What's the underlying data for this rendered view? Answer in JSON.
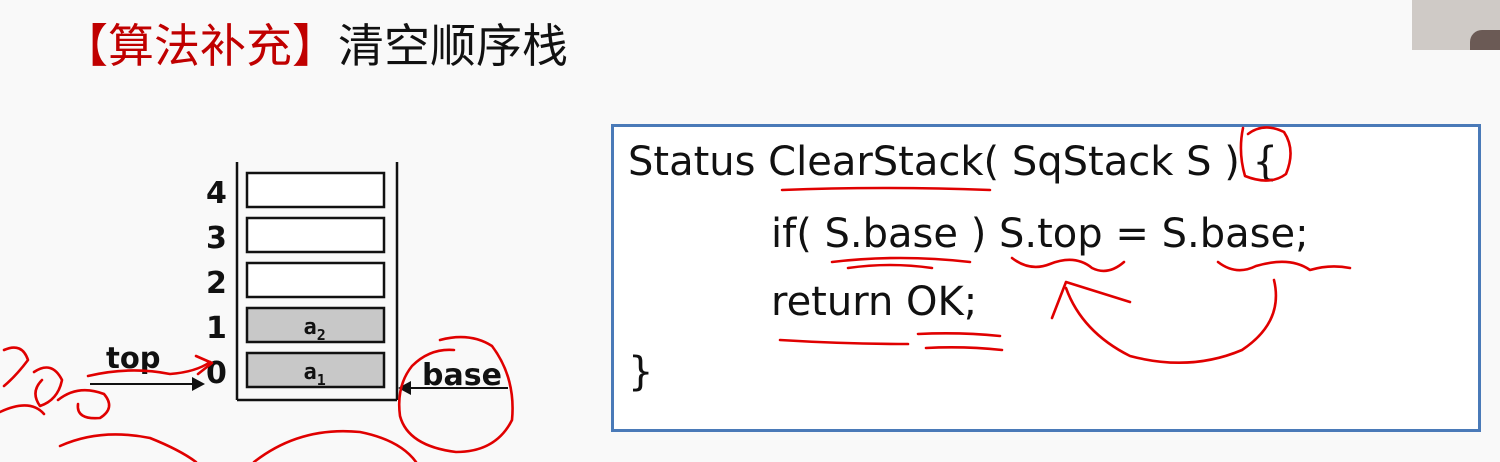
{
  "title": {
    "bracket_text": "【算法补充】",
    "main_text": "清空顺序栈"
  },
  "stack": {
    "indices": [
      "4",
      "3",
      "2",
      "1",
      "0"
    ],
    "cells": [
      {
        "label": "",
        "filled": false
      },
      {
        "label": "",
        "filled": false
      },
      {
        "label": "",
        "filled": false
      },
      {
        "label": "a",
        "sub": "2",
        "filled": true
      },
      {
        "label": "a",
        "sub": "1",
        "filled": true
      }
    ],
    "top_label": "top",
    "base_label": "base"
  },
  "code": {
    "lines": [
      "Status ClearStack( SqStack S ) {",
      "if( S.base ) S.top = S.base;",
      "return OK;",
      "}"
    ]
  },
  "colors": {
    "title_bracket": "#c00000",
    "ink": "#e00000",
    "box_border": "#4a7ab8",
    "cell_fill": "#c8c8c8"
  }
}
